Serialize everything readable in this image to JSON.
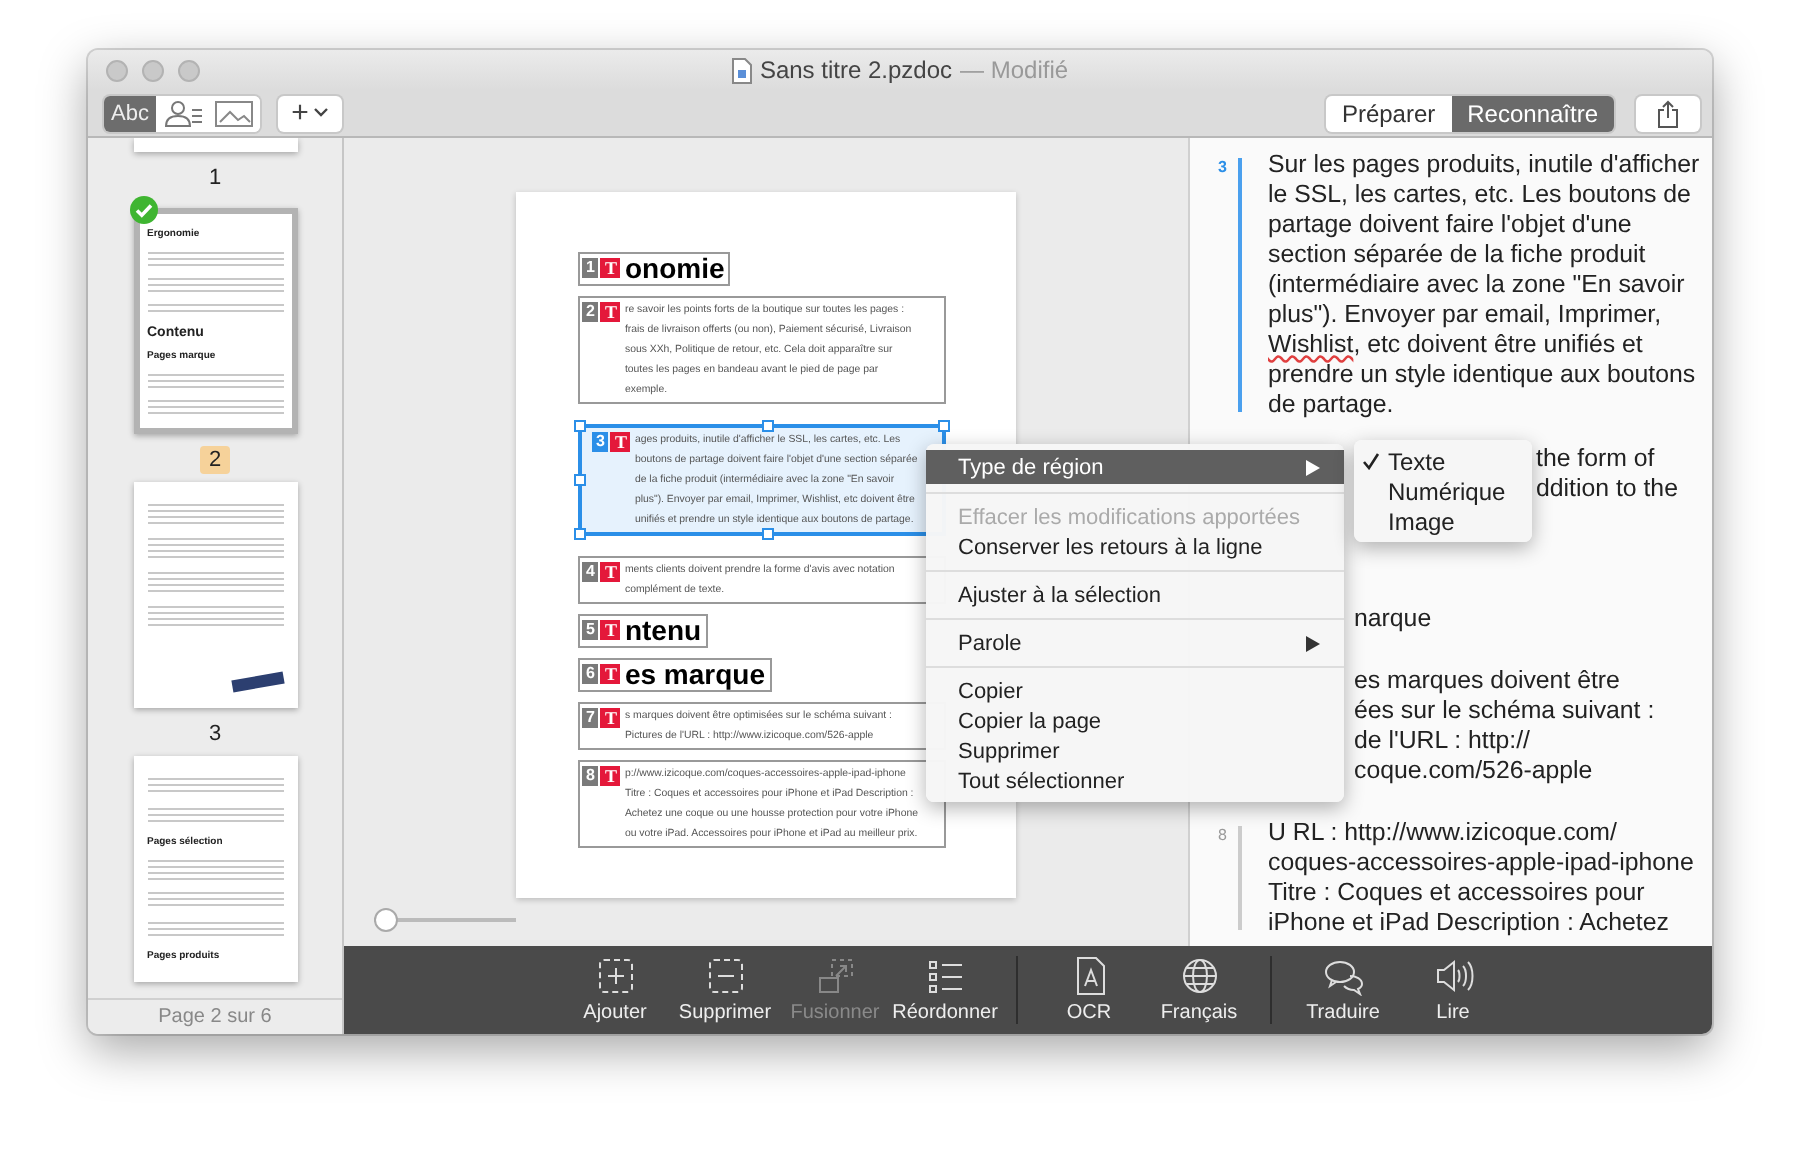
{
  "window": {
    "title": "Sans titre 2.pzdoc",
    "subtitle": "— Modifié"
  },
  "toolbar": {
    "modes": [
      {
        "kind": "text",
        "label": "Abc",
        "selected": true
      },
      {
        "kind": "person",
        "selected": false
      },
      {
        "kind": "image",
        "selected": false
      }
    ],
    "add_button": "+",
    "steps": [
      {
        "label": "Préparer",
        "selected": false
      },
      {
        "label": "Reconnaître",
        "selected": true
      }
    ]
  },
  "sidebar": {
    "pages": [
      {
        "label": "1",
        "cut": true,
        "selected": false,
        "checked": false
      },
      {
        "label": "2",
        "cut": false,
        "selected": true,
        "checked": true,
        "blocks": [
          {
            "kind": "heading",
            "text": "Ergonomie"
          },
          {
            "kind": "paragraph"
          },
          {
            "kind": "paragraph"
          },
          {
            "kind": "paragraph"
          },
          {
            "kind": "title",
            "text": "Contenu"
          },
          {
            "kind": "heading",
            "text": "Pages marque"
          },
          {
            "kind": "paragraph"
          },
          {
            "kind": "paragraph"
          }
        ]
      },
      {
        "label": "3",
        "cut": false,
        "selected": false,
        "checked": false,
        "blocks": [
          {
            "kind": "paragraph"
          },
          {
            "kind": "paragraph"
          },
          {
            "kind": "paragraph"
          },
          {
            "kind": "paragraph"
          },
          {
            "kind": "photo"
          }
        ]
      },
      {
        "cut": false,
        "selected": false,
        "checked": false,
        "blocks": [
          {
            "kind": "paragraph"
          },
          {
            "kind": "paragraph"
          },
          {
            "kind": "heading",
            "text": "Pages sélection"
          },
          {
            "kind": "paragraph"
          },
          {
            "kind": "paragraph"
          },
          {
            "kind": "paragraph"
          },
          {
            "kind": "heading",
            "text": "Pages produits"
          }
        ]
      }
    ],
    "footer": "Page 2 sur 6"
  },
  "document": {
    "regions": [
      {
        "number": "1",
        "tag": "T",
        "kind": "heading",
        "text": "onomie",
        "selected": false
      },
      {
        "number": "2",
        "tag": "T",
        "kind": "text",
        "text": "re savoir les points forts de la boutique sur toutes les pages : frais de livraison offerts (ou non), Paiement sécurisé, Livraison sous XXh, Politique de retour, etc. Cela doit apparaître sur toutes les pages en bandeau avant le pied de page par exemple.",
        "selected": false
      },
      {
        "number": "3",
        "tag": "T",
        "kind": "text",
        "text": "ages produits, inutile d'afficher le SSL, les cartes, etc. Les boutons de partage doivent faire l'objet d'une section séparée de la fiche produit (intermédiaire avec la zone \"En savoir plus\"). Envoyer par email, Imprimer, Wishlist, etc doivent être unifiés et prendre un style identique aux boutons de partage.",
        "selected": true
      },
      {
        "number": "4",
        "tag": "T",
        "kind": "text",
        "text": "ments clients doivent prendre la forme d'avis avec notation complément de texte.",
        "selected": false
      },
      {
        "number": "5",
        "tag": "T",
        "kind": "heading",
        "text": "ntenu",
        "selected": false
      },
      {
        "number": "6",
        "tag": "T",
        "kind": "heading",
        "text": "es marque",
        "selected": false
      },
      {
        "number": "7",
        "tag": "T",
        "kind": "text",
        "text": "s marques doivent être optimisées sur le schéma suivant : Pictures de l'URL : http://www.izicoque.com/526-apple",
        "selected": false
      },
      {
        "number": "8",
        "tag": "T",
        "kind": "text",
        "text": "p://www.izicoque.com/coques-accessoires-apple-ipad-iphone Titre : Coques et accessoires pour iPhone et iPad Description : Achetez une coque ou une housse protection pour votre iPhone ou votre iPad. Accessoires pour iPhone et iPad au meilleur prix.",
        "selected": false
      }
    ],
    "zoom_slider": {
      "level": 0
    }
  },
  "context_menu": {
    "items": [
      {
        "kind": "item",
        "label": "Type de région",
        "selected": true,
        "disabled": false,
        "submenu": true
      },
      {
        "kind": "separator"
      },
      {
        "kind": "item",
        "label": "Effacer les modifications apportées",
        "selected": false,
        "disabled": true,
        "submenu": false
      },
      {
        "kind": "item",
        "label": "Conserver les retours à la ligne",
        "selected": false,
        "disabled": false,
        "submenu": false
      },
      {
        "kind": "separator"
      },
      {
        "kind": "item",
        "label": "Ajuster à la sélection",
        "selected": false,
        "disabled": false,
        "submenu": false
      },
      {
        "kind": "separator"
      },
      {
        "kind": "item",
        "label": "Parole",
        "selected": false,
        "disabled": false,
        "submenu": true
      },
      {
        "kind": "separator"
      },
      {
        "kind": "item",
        "label": "Copier",
        "selected": false,
        "disabled": false,
        "submenu": false
      },
      {
        "kind": "item",
        "label": "Copier la page",
        "selected": false,
        "disabled": false,
        "submenu": false
      },
      {
        "kind": "item",
        "label": "Supprimer",
        "selected": false,
        "disabled": false,
        "submenu": false
      },
      {
        "kind": "item",
        "label": "Tout sélectionner",
        "selected": false,
        "disabled": false,
        "submenu": false
      }
    ]
  },
  "submenu": {
    "items": [
      {
        "label": "Texte",
        "checked": true
      },
      {
        "label": "Numérique",
        "checked": false
      },
      {
        "label": "Image",
        "checked": false
      }
    ]
  },
  "text_panel": {
    "paragraphs": [
      {
        "kind": "full",
        "number": "3",
        "selected": true,
        "text": "Sur les pages produits, inutile d'afficher le SSL, les cartes, etc. Les boutons de partage doivent faire l'objet d'une section séparée de la fiche produit (intermédiaire avec la zone \"En savoir plus\"). Envoyer par email, Imprimer, **Wishlist**, etc doivent être unifiés et prendre un style identique aux boutons de partage."
      },
      {
        "kind": "beside_submenu",
        "lines": [
          "the form of",
          "ddition to the"
        ]
      },
      {
        "kind": "beside_menu",
        "lines": [
          "narque"
        ]
      },
      {
        "kind": "beside_menu",
        "lines": [
          "es marques doivent être",
          "ées sur le schéma suivant :",
          "de l'URL : http://",
          "coque.com/526-apple"
        ]
      },
      {
        "kind": "full",
        "number": "8",
        "selected": false,
        "text": "U RL : http://www.izicoque.com/ coques-accessoires-apple-ipad-iphone Titre : Coques et accessoires pour iPhone et iPad Description : Achetez"
      }
    ]
  },
  "bottom_toolbar": {
    "groups": [
      [
        {
          "kind": "add",
          "label": "Ajouter",
          "disabled": false
        },
        {
          "kind": "remove",
          "label": "Supprimer",
          "disabled": false
        },
        {
          "kind": "merge",
          "label": "Fusionner",
          "disabled": true
        },
        {
          "kind": "reorder",
          "label": "Réordonner",
          "disabled": false
        }
      ],
      [
        {
          "kind": "ocr",
          "label": "OCR",
          "disabled": false
        },
        {
          "kind": "language",
          "label": "Français",
          "disabled": false
        }
      ],
      [
        {
          "kind": "translate",
          "label": "Traduire",
          "disabled": false
        },
        {
          "kind": "speak",
          "label": "Lire",
          "disabled": false
        }
      ]
    ]
  }
}
